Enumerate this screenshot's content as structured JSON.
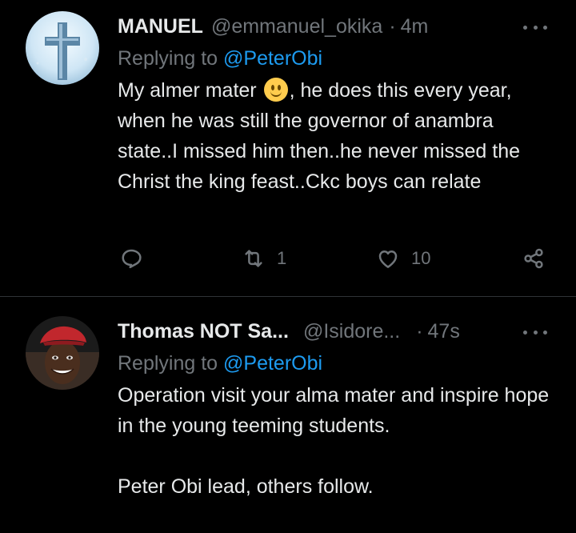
{
  "tweets": [
    {
      "name": "MANUEL",
      "handle": "@emmanuel_okika",
      "time": "4m",
      "replying_prefix": "Replying to",
      "replying_to": "@PeterObi",
      "text_before_emoji": "My almer mater",
      "text_after_emoji": ", he does this every year, when he was still the governor of anambra state..I missed him then..he never missed the Christ the king feast..Ckc boys can relate",
      "retweet_count": "1",
      "like_count": "10",
      "avatar_icon": "cross-avatar-icon"
    },
    {
      "name": "Thomas NOT Sa...",
      "handle": "@Isidore...",
      "time": "47s",
      "replying_prefix": "Replying to",
      "replying_to": "@PeterObi",
      "paragraph1": "Operation visit your alma mater and inspire hope in the young teeming students.",
      "paragraph2": "Peter Obi lead, others follow.",
      "avatar_icon": "person-beret-avatar-icon"
    }
  ],
  "colors": {
    "background": "#000000",
    "text": "#e7e9ea",
    "muted": "#71767b",
    "link": "#1d9bf0",
    "divider": "#2f3336"
  }
}
